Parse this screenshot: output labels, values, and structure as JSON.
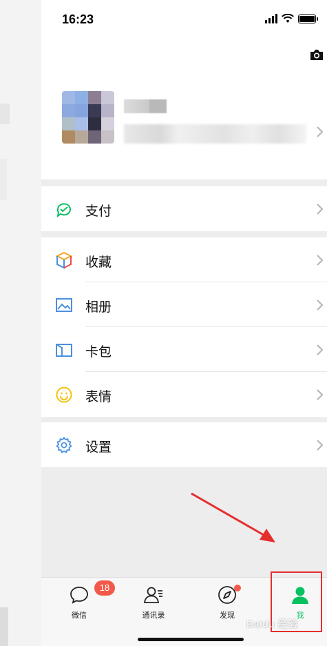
{
  "status_bar": {
    "time": "16:23"
  },
  "menu": {
    "pay": {
      "label": "支付",
      "icon": "wallet-check-icon"
    },
    "favorites": {
      "label": "收藏",
      "icon": "cube-icon"
    },
    "album": {
      "label": "相册",
      "icon": "image-icon"
    },
    "cards": {
      "label": "卡包",
      "icon": "card-icon"
    },
    "stickers": {
      "label": "表情",
      "icon": "smiley-icon"
    },
    "settings": {
      "label": "设置",
      "icon": "gear-icon"
    }
  },
  "tabbar": {
    "chats": {
      "label": "微信",
      "badge": "18"
    },
    "contacts": {
      "label": "通讯录"
    },
    "discover": {
      "label": "发现"
    },
    "me": {
      "label": "我"
    }
  },
  "watermark": "Baidu 经验",
  "colors": {
    "accent_green": "#07c160",
    "badge_red": "#f15a4a",
    "annotation_red": "#e52e2e"
  }
}
